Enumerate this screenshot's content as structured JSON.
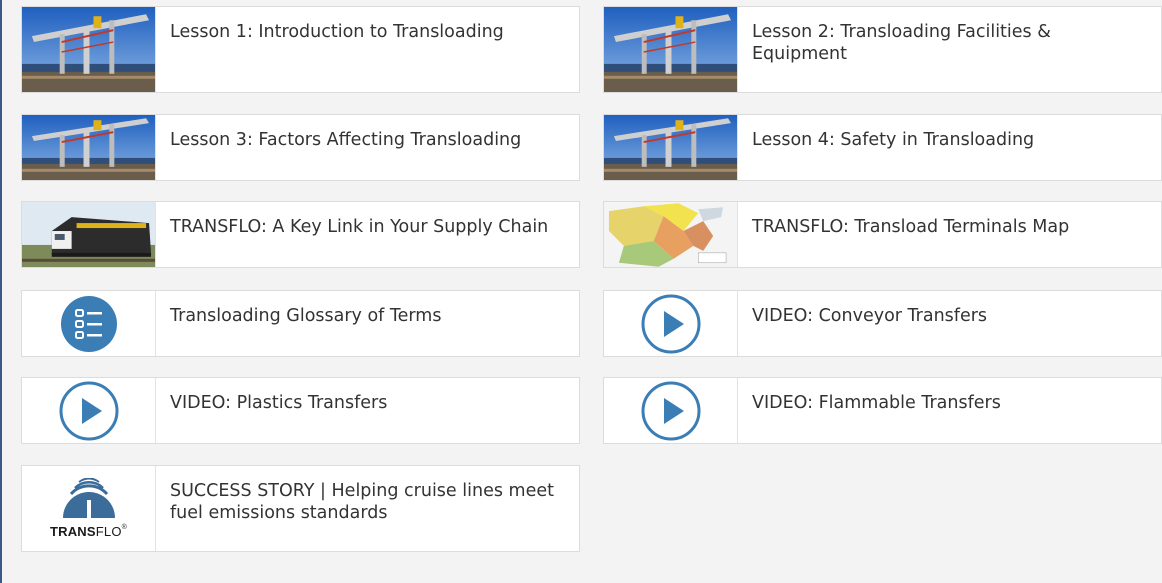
{
  "resources": [
    {
      "title": "Lesson 1: Introduction to Transloading",
      "icon": "crane-photo-thumbnail"
    },
    {
      "title": "Lesson 2: Transloading Facilities & Equipment",
      "icon": "crane-photo-thumbnail"
    },
    {
      "title": "Lesson 3: Factors Affecting Transloading",
      "icon": "crane-photo-thumbnail"
    },
    {
      "title": "Lesson 4: Safety in Transloading",
      "icon": "crane-photo-thumbnail"
    },
    {
      "title": "TRANSFLO: A Key Link in Your Supply Chain",
      "icon": "locomotive-photo-thumbnail"
    },
    {
      "title": "TRANSFLO: Transload Terminals Map",
      "icon": "map-thumbnail"
    },
    {
      "title": "Transloading Glossary of Terms",
      "icon": "list-icon"
    },
    {
      "title": "VIDEO: Conveyor Transfers",
      "icon": "play-icon"
    },
    {
      "title": "VIDEO: Plastics Transfers",
      "icon": "play-icon"
    },
    {
      "title": "VIDEO: Flammable Transfers",
      "icon": "play-icon"
    },
    {
      "title": "SUCCESS STORY | Helping cruise lines meet fuel emissions standards",
      "icon": "transflo-logo"
    }
  ],
  "logo": {
    "bold": "TRANS",
    "light": "FLO",
    "mark": "®"
  },
  "colors": {
    "accent_blue": "#3b7db5",
    "text": "#333333",
    "card_border": "#dcdcdc",
    "background": "#f3f3f3"
  }
}
